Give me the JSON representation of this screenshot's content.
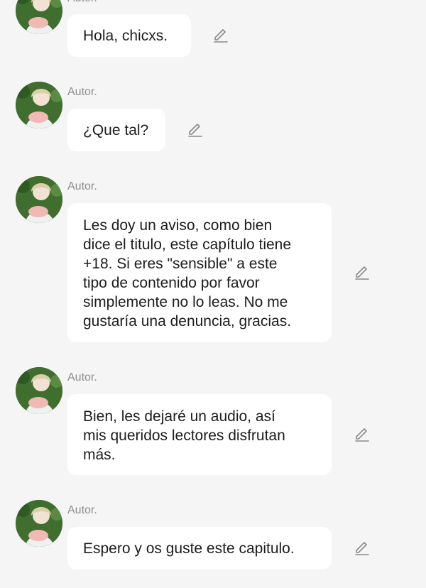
{
  "messages": [
    {
      "author": "Autor.",
      "lines": [
        "Hola, chicxs."
      ],
      "edit_icon": "pencil-icon"
    },
    {
      "author": "Autor.",
      "lines": [
        "¿Que tal?"
      ],
      "edit_icon": "pencil-icon"
    },
    {
      "author": "Autor.",
      "lines": [
        "Les doy un aviso, como bien",
        "dice el titulo, este capítulo tiene",
        "+18. Si eres \"sensible\" a este",
        "tipo de contenido por favor",
        "simplemente no lo leas. No me",
        "gustaría una denuncia, gracias."
      ],
      "edit_icon": "pencil-icon"
    },
    {
      "author": "Autor.",
      "lines": [
        "Bien, les dejaré un audio, así",
        "mis queridos lectores disfrutan",
        "más."
      ],
      "edit_icon": "pencil-icon"
    },
    {
      "author": "Autor.",
      "lines": [
        "Espero y os guste este capitulo."
      ],
      "edit_icon": "pencil-icon"
    }
  ],
  "colors": {
    "background": "#f5f5f5",
    "bubble": "#ffffff",
    "text": "#1c1c1c",
    "author": "#8e8e8e",
    "icon": "#8a8a8a"
  }
}
